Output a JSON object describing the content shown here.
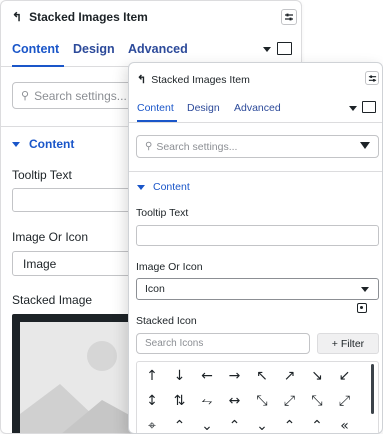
{
  "back_panel": {
    "title": "Stacked Images Item",
    "tabs": [
      "Content",
      "Design",
      "Advanced"
    ],
    "search_placeholder": "Search settings...",
    "section": "Content",
    "tooltip_label": "Tooltip Text",
    "image_or_icon_label": "Image Or Icon",
    "image_or_icon_value": "Image",
    "stacked_image_label": "Stacked Image"
  },
  "front_panel": {
    "title": "Stacked Images Item",
    "tabs": [
      "Content",
      "Design",
      "Advanced"
    ],
    "search_placeholder": "Search settings...",
    "section": "Content",
    "tooltip_label": "Tooltip Text",
    "image_or_icon_label": "Image Or Icon",
    "image_or_icon_value": "Icon",
    "stacked_icon_label": "Stacked Icon",
    "icon_search_placeholder": "Search Icons",
    "filter_label": "+ Filter",
    "icons": [
      "↑",
      "↓",
      "←",
      "→",
      "↖",
      "↗",
      "↘",
      "↙",
      "↕",
      "⇅",
      "⥊",
      "↔",
      "⤡",
      "⤢",
      "⤡",
      "⤢",
      "⌖",
      "⌃",
      "⌄",
      "⌃",
      "⌄",
      "⌃",
      "⌃",
      "«"
    ]
  },
  "icons": {
    "back": "arrow-return-icon",
    "settings": "sliders-icon",
    "search": "magnifier-icon",
    "filter": "funnel-icon",
    "dynamic": "dynamic-data-icon"
  },
  "colors": {
    "accent": "#1a56c9",
    "border": "#dcdcde",
    "text": "#1d2327"
  }
}
